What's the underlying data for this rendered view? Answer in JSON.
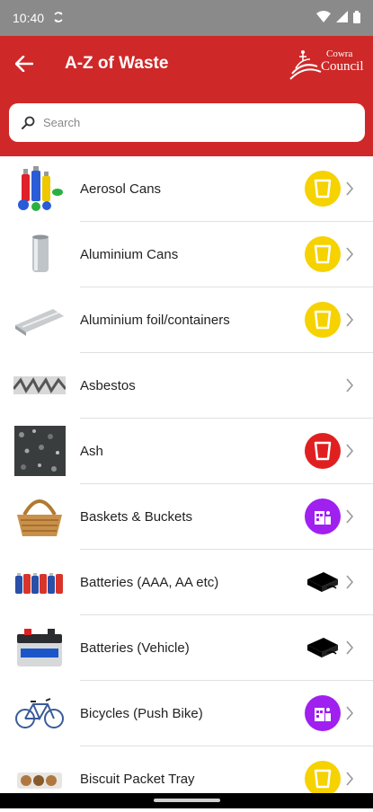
{
  "status": {
    "time": "10:40"
  },
  "header": {
    "title": "A-Z of Waste",
    "logo_text_1": "Cowra",
    "logo_text_2": "Council"
  },
  "search": {
    "placeholder": "Search"
  },
  "colors": {
    "brand_red": "#cf2828",
    "yellow_bin": "#f5d200",
    "red_bin": "#e02020",
    "purple_bin": "#a020f0"
  },
  "items": [
    {
      "label": "Aerosol Cans",
      "bin": "yellow-bin-icon"
    },
    {
      "label": "Aluminium Cans",
      "bin": "yellow-bin-icon"
    },
    {
      "label": "Aluminium foil/containers",
      "bin": "yellow-bin-icon"
    },
    {
      "label": "Asbestos",
      "bin": ""
    },
    {
      "label": "Ash",
      "bin": "red-bin-icon"
    },
    {
      "label": "Baskets & Buckets",
      "bin": "purple-shop-icon"
    },
    {
      "label": "Batteries (AAA, AA etc)",
      "bin": "drop-off-tray-icon"
    },
    {
      "label": "Batteries (Vehicle)",
      "bin": "drop-off-tray-icon"
    },
    {
      "label": "Bicycles (Push Bike)",
      "bin": "purple-shop-icon"
    },
    {
      "label": "Biscuit Packet Tray",
      "bin": "yellow-bin-icon"
    }
  ]
}
